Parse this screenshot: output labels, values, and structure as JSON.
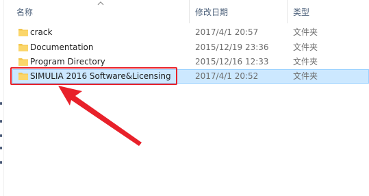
{
  "columns": {
    "name": "名称",
    "modified": "修改日期",
    "type": "类型"
  },
  "files": [
    {
      "name": "crack",
      "modified": "2017/4/1 20:57",
      "type": "文件夹",
      "selected": false
    },
    {
      "name": "Documentation",
      "modified": "2015/12/19 23:36",
      "type": "文件夹",
      "selected": false
    },
    {
      "name": "Program Directory",
      "modified": "2015/12/16 12:33",
      "type": "文件夹",
      "selected": false
    },
    {
      "name": "SIMULIA 2016 Software&Licensing",
      "modified": "2017/4/1 20:52",
      "type": "文件夹",
      "selected": true
    }
  ],
  "colors": {
    "selection_bg": "#cce8ff",
    "selection_border": "#99d1ff",
    "folder": "#f3c64d",
    "annotation": "#e8212a"
  },
  "icons": {
    "folder": "folder-icon",
    "sort": "sort-ascending-icon",
    "annotation": "red-arrow-annotation"
  }
}
